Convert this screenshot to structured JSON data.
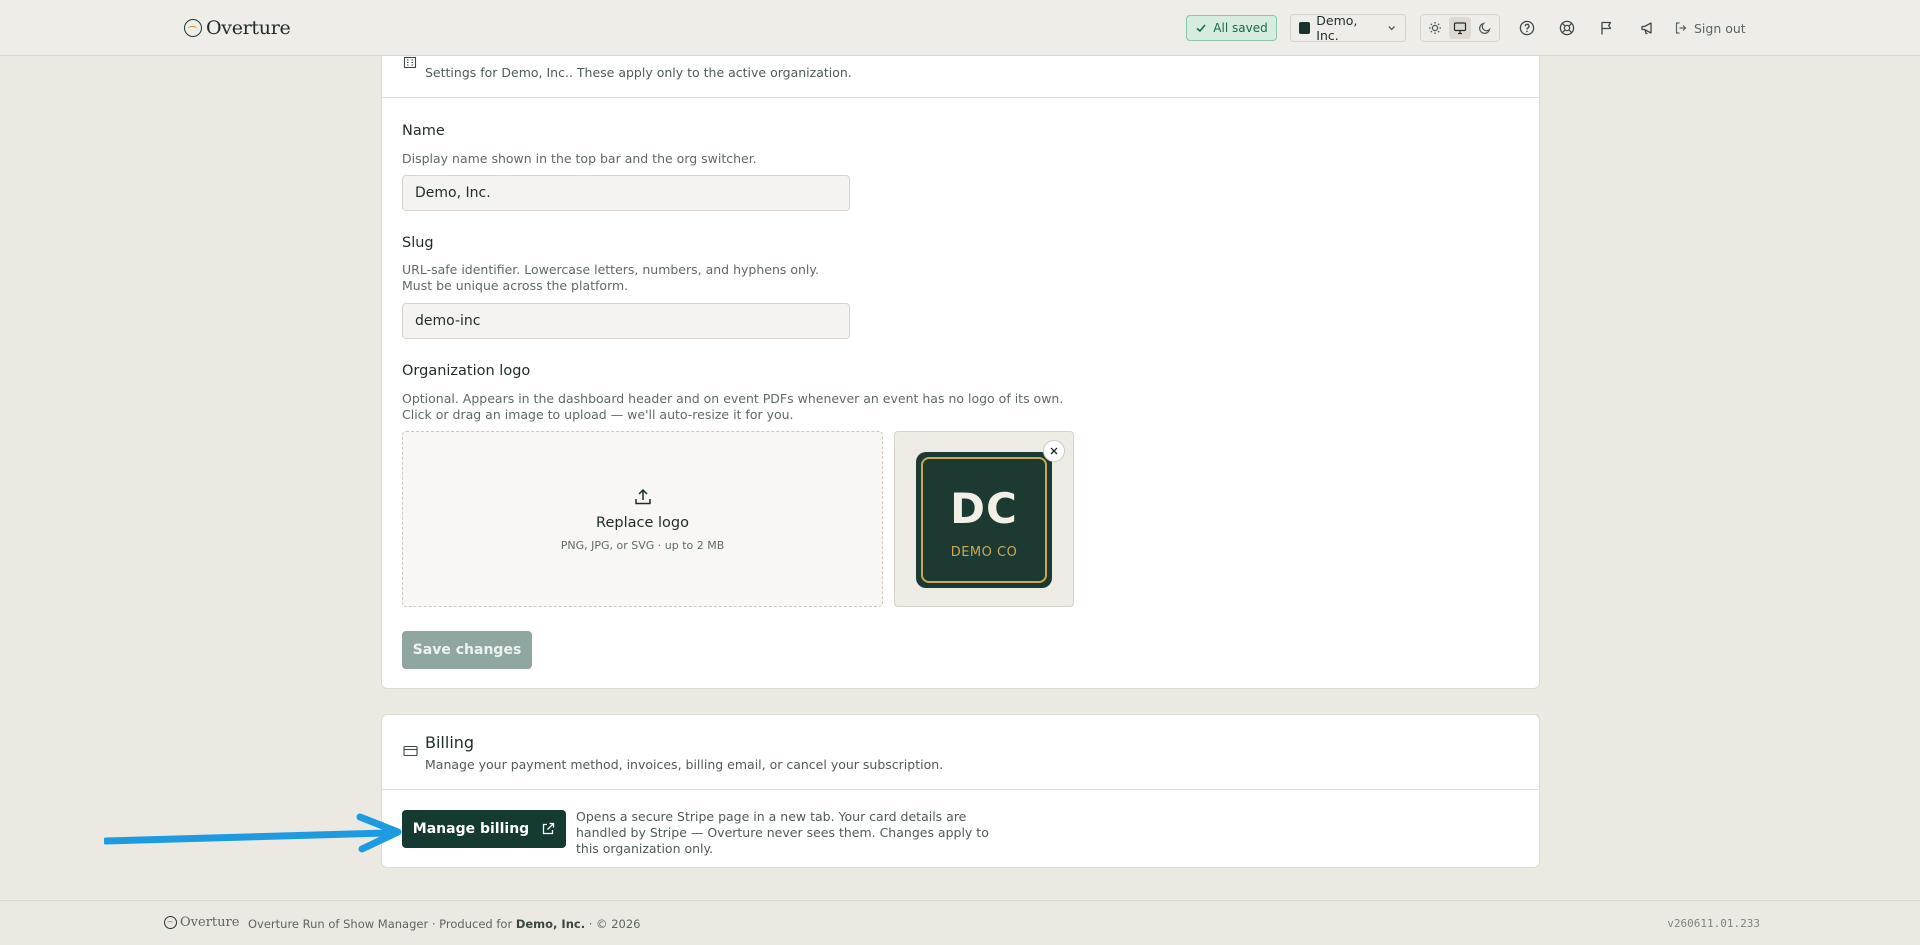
{
  "header": {
    "brand": "Overture",
    "saved_status": "All saved",
    "org_switcher_label": "Demo, Inc.",
    "signout_label": "Sign out"
  },
  "org_card": {
    "subtitle": "Settings for Demo, Inc.. These apply only to the active organization.",
    "name_field": {
      "label": "Name",
      "help": "Display name shown in the top bar and the org switcher.",
      "value": "Demo, Inc."
    },
    "slug_field": {
      "label": "Slug",
      "help": "URL-safe identifier. Lowercase letters, numbers, and hyphens only. Must be unique across the platform.",
      "value": "demo-inc"
    },
    "logo_field": {
      "label": "Organization logo",
      "help": "Optional. Appears in the dashboard header and on event PDFs whenever an event has no logo of its own. Click or drag an image to upload — we'll auto-resize it for you.",
      "dropzone_title": "Replace logo",
      "dropzone_hint": "PNG, JPG, or SVG · up to 2 MB",
      "preview_initials": "DC",
      "preview_caption": "DEMO CO"
    },
    "save_label": "Save changes"
  },
  "billing_card": {
    "title": "Billing",
    "subtitle": "Manage your payment method, invoices, billing email, or cancel your subscription.",
    "manage_label": "Manage billing",
    "note": "Opens a secure Stripe page in a new tab. Your card details are handled by Stripe — Overture never sees them. Changes apply to this organization only."
  },
  "footer": {
    "brand": "Overture",
    "text_prefix": "Overture Run of Show Manager · Produced for",
    "org_name": "Demo, Inc.",
    "text_suffix": "· © 2026",
    "version": "v260611.01.233"
  },
  "colors": {
    "accent": "#143a31",
    "page_bg": "#ece9e3",
    "saved_bg": "#d6ecde",
    "annotation_arrow": "#1e9be0"
  },
  "icons": {
    "saved": "check-icon",
    "org": "org-square-icon",
    "theme": [
      "sun-icon",
      "monitor-icon",
      "moon-icon"
    ],
    "toolbar": [
      "help-icon",
      "support-icon",
      "flag-icon",
      "megaphone-icon"
    ],
    "signout": "sign-out-icon",
    "org_card": "building-icon",
    "upload": "upload-icon",
    "remove_logo": "close-icon",
    "billing": "credit-card-icon",
    "external": "external-link-icon"
  }
}
